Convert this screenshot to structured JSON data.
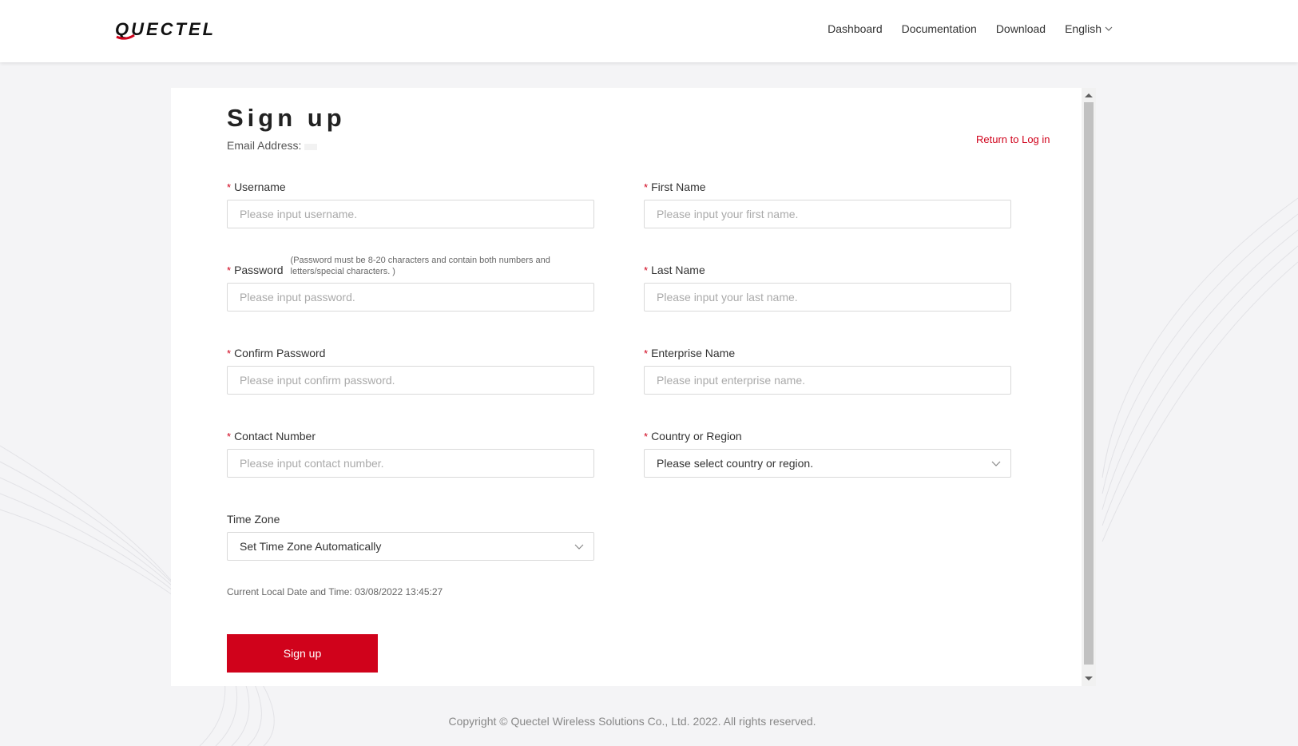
{
  "brand": {
    "logo_text": "QUECTEL",
    "accent_color": "#d0021b"
  },
  "nav": {
    "items": [
      "Dashboard",
      "Documentation",
      "Download"
    ],
    "language": "English"
  },
  "form": {
    "title": "Sign up",
    "email_label": "Email Address:",
    "return_link": "Return to Log in",
    "username": {
      "label": "Username",
      "placeholder": "Please input username."
    },
    "first_name": {
      "label": "First Name",
      "placeholder": "Please input your first name."
    },
    "password": {
      "label": "Password",
      "hint": "(Password must be 8-20 characters and contain both numbers and letters/special characters. )",
      "placeholder": "Please input password."
    },
    "last_name": {
      "label": "Last Name",
      "placeholder": "Please input your last name."
    },
    "confirm_password": {
      "label": "Confirm Password",
      "placeholder": "Please input confirm password."
    },
    "enterprise_name": {
      "label": "Enterprise Name",
      "placeholder": "Please input enterprise name."
    },
    "contact_number": {
      "label": "Contact Number",
      "placeholder": "Please input contact number."
    },
    "country": {
      "label": "Country or Region",
      "value": "Please select country or region."
    },
    "time_zone": {
      "label": "Time Zone",
      "value": "Set Time Zone Automatically"
    },
    "time_note": "Current Local Date and Time: 03/08/2022 13:45:27",
    "submit": "Sign up"
  },
  "footer": {
    "copyright": "Copyright © Quectel Wireless Solutions Co., Ltd. 2022. All rights reserved."
  }
}
